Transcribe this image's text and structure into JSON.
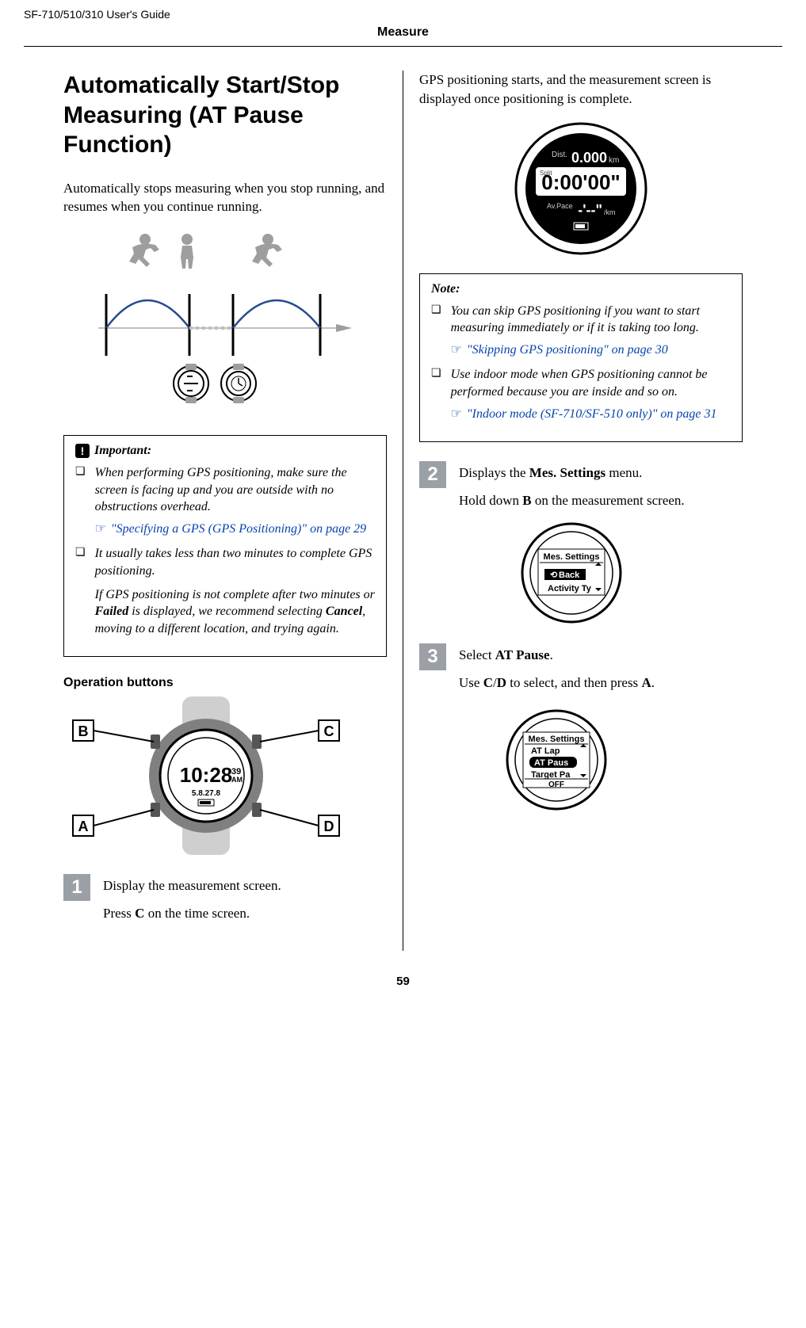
{
  "header": {
    "product": "SF-710/510/310     User's Guide",
    "section": "Measure"
  },
  "left": {
    "title": "Automatically Start/Stop Measuring (AT Pause Function)",
    "intro": "Automatically stops measuring when you stop running, and resumes when you continue running.",
    "important": {
      "title": "Important:",
      "items": [
        {
          "text": "When performing GPS positioning, make sure the screen is facing up and you are outside with no obstructions overhead.",
          "link": "\"Specifying a GPS (GPS Positioning)\" on page 29"
        },
        {
          "text": "It usually takes less than two minutes to complete GPS positioning.",
          "sub_before": "If GPS positioning is not complete after two minutes or ",
          "sub_bold1": "Failed",
          "sub_mid": " is displayed, we recommend selecting ",
          "sub_bold2": "Cancel",
          "sub_after": ", moving to a different location, and trying again."
        }
      ]
    },
    "op_label": "Operation buttons",
    "buttons": {
      "A": "A",
      "B": "B",
      "C": "C",
      "D": "D"
    },
    "step1": {
      "num": "1",
      "line1": "Display the measurement screen.",
      "line2_before": "Press ",
      "line2_bold": "C",
      "line2_after": " on the time screen."
    }
  },
  "right": {
    "gps_text": "GPS positioning starts, and the measurement screen is displayed once positioning is complete.",
    "watch_face": {
      "dist_label": "Dist.",
      "dist_value": "0.000",
      "dist_unit": "km",
      "split_label": "Split",
      "split_value": "0:00'00\"",
      "pace_label": "Av.Pace",
      "pace_value": "-'--\"",
      "pace_unit": "/km"
    },
    "note": {
      "title": "Note:",
      "items": [
        {
          "text": "You can skip GPS positioning if you want to start measuring immediately or if it is taking too long.",
          "link": "\"Skipping GPS positioning\" on page 30"
        },
        {
          "text": "Use indoor mode when GPS positioning cannot be performed because you are inside and so on.",
          "link": "\"Indoor mode (SF-710/SF-510 only)\" on page 31"
        }
      ]
    },
    "step2": {
      "num": "2",
      "line1_before": "Displays the ",
      "line1_bold": "Mes. Settings",
      "line1_after": " menu.",
      "line2_before": "Hold down ",
      "line2_bold": "B",
      "line2_after": " on the measurement screen.",
      "screen": {
        "title": "Mes. Settings",
        "item_hi": "Back",
        "item_below": "Activity Ty"
      }
    },
    "step3": {
      "num": "3",
      "line1_before": "Select ",
      "line1_bold": "AT Pause",
      "line1_after": ".",
      "line2_before": "Use ",
      "line2_bold1": "C",
      "line2_mid1": "/",
      "line2_bold2": "D",
      "line2_mid2": " to select, and then press ",
      "line2_bold3": "A",
      "line2_after": ".",
      "screen": {
        "title": "Mes. Settings",
        "line1": "AT Lap",
        "line_hi": "AT Paus",
        "line3": "Target Pa",
        "footer": "OFF"
      }
    }
  },
  "page_number": "59"
}
